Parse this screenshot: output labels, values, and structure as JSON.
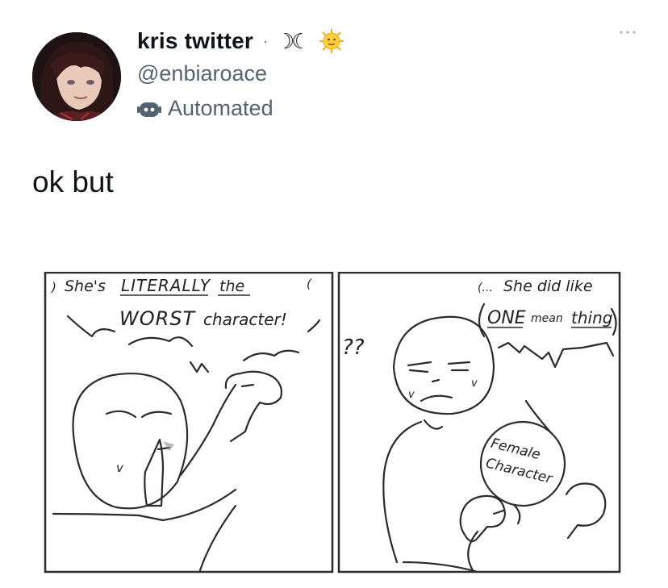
{
  "tweet": {
    "display_name": "kris twitter",
    "separator": "·",
    "name_decoration": "☽☾",
    "sun_emoji": "sun-with-face-icon",
    "handle": "@enbiaroace",
    "automated_label": "Automated",
    "body_text": "ok but"
  },
  "comic": {
    "panel1": {
      "line1_prefix": "She's",
      "line1_caps": "LITERALLY",
      "line1_suffix": "the",
      "line2_caps": "WORST",
      "line2_suffix": "character!",
      "mark_left": ")",
      "mark_right": "("
    },
    "panel2": {
      "question": "??",
      "line1_prefix": "(...",
      "line1": "She did like",
      "line2_caps": "ONE",
      "line2_mean": "mean",
      "line2_suffix": "thing",
      "sign_line1": "Female",
      "sign_line2": "Character"
    }
  },
  "colors": {
    "text": "#0f1419",
    "secondary": "#536471",
    "ink": "#2b2b2b"
  }
}
